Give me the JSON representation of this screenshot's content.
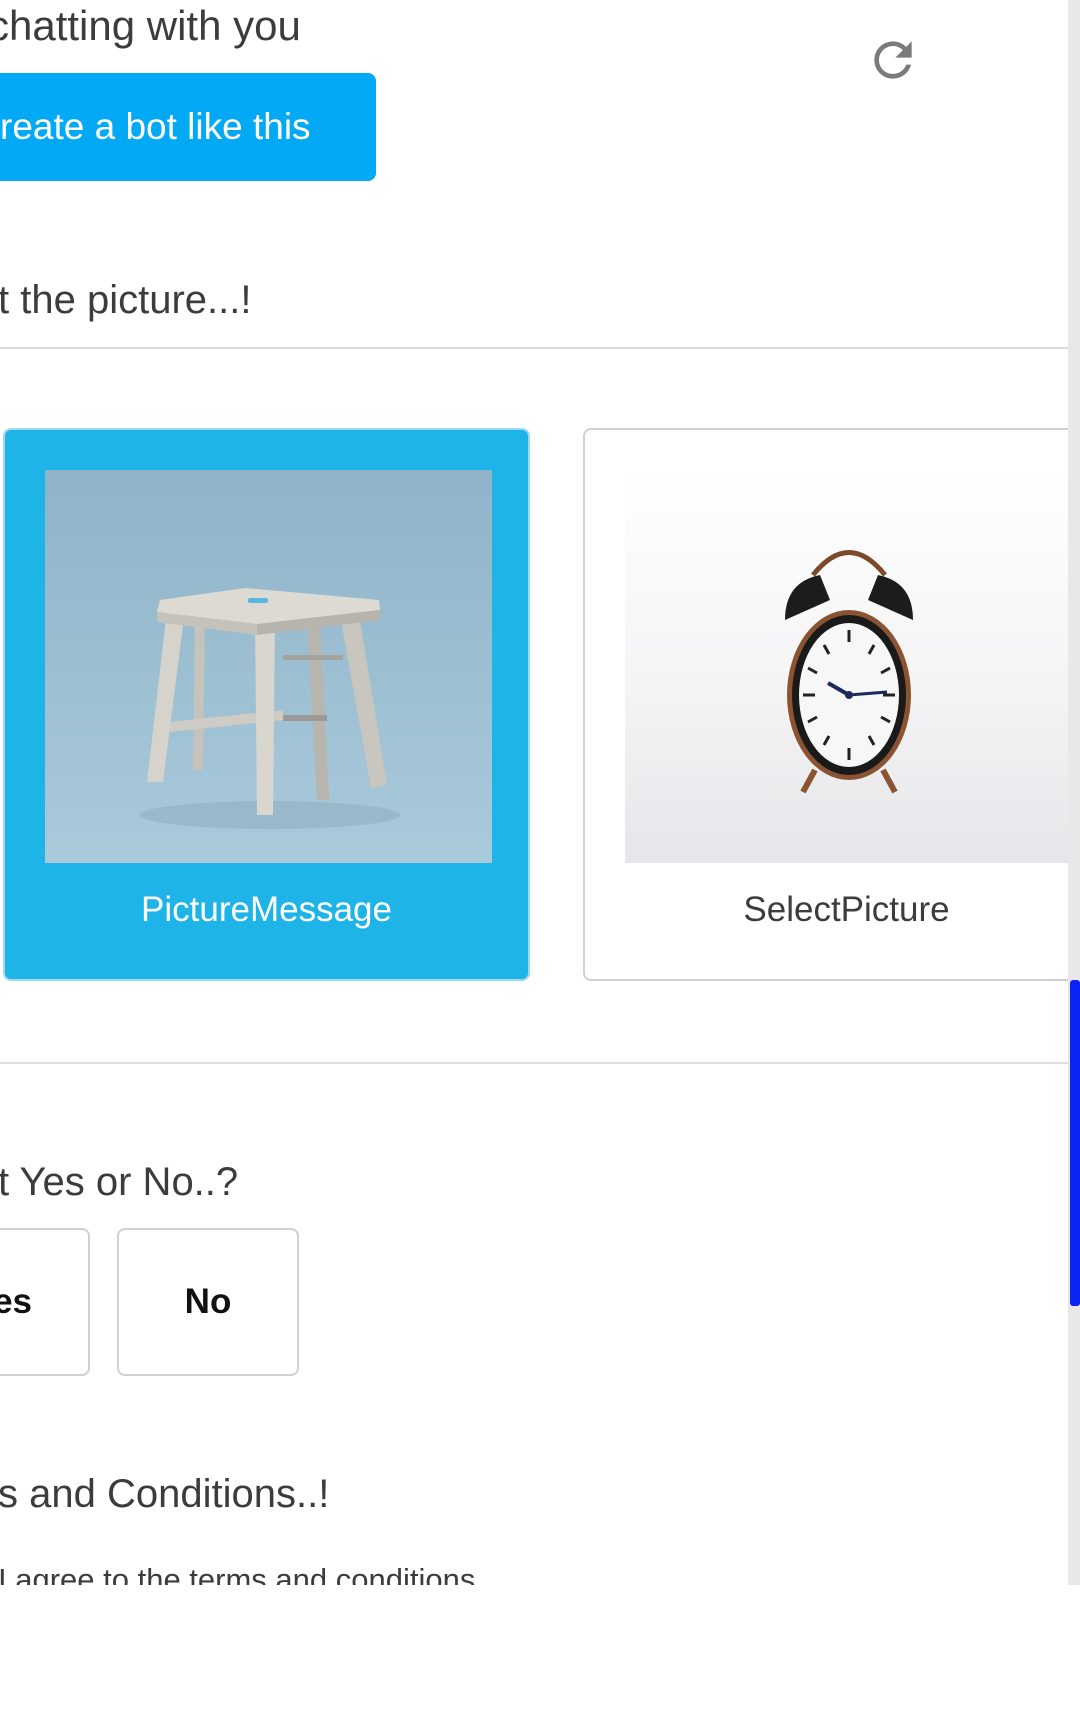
{
  "header": {
    "chat_text": "chatting with you",
    "create_button_label": "reate a bot like this"
  },
  "icons": {
    "refresh": "refresh-icon"
  },
  "picture_question": {
    "text": "t the picture...!",
    "options": [
      {
        "label": "PictureMessage",
        "selected": true,
        "image": "wooden-stool"
      },
      {
        "label": "SelectPicture",
        "selected": false,
        "image": "alarm-clock"
      }
    ]
  },
  "yes_no_question": {
    "text": "t Yes or No..?",
    "yes_label": "es",
    "no_label": "No"
  },
  "terms": {
    "title": "s and Conditions..!",
    "agree_text": "I agree to the terms and conditions"
  },
  "colors": {
    "accent": "#03a9f4",
    "selected_card": "#1eb4e7",
    "scrollbar_thumb": "#0b24f5"
  }
}
